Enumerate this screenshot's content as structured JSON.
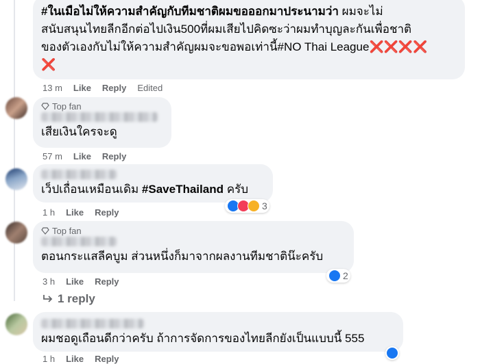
{
  "comments": [
    {
      "text_line1_bold": "#ในเมือไม่ให้ความสำคัญกับทีมชาติผมขอออกมาประนามว่า",
      "text_line1_rest": " ผมจะไม่",
      "text_line2": "สนับสนุนไทยลีกอีกต่อไปเงิน500ที่ผมเสียไปคิดซะว่าผมทำบุญละกันเพื่อชาติ",
      "text_line3": "ของตัวเองกับไม่ให้ความสำคัญผมจะขอพอเท่านี้",
      "hashtag": "#NO Thai League",
      "crosses": "❌❌❌❌",
      "cross_last": "❌",
      "time": "13 m",
      "like": "Like",
      "reply": "Reply",
      "edited": "Edited"
    },
    {
      "badge": "Top fan",
      "text": "เสียเงินใครจะดู",
      "time": "57 m",
      "like": "Like",
      "reply": "Reply"
    },
    {
      "text_plain": "เว็ปเถื่อนเหมือนเดิม ",
      "hashtag": "#SaveThailand",
      "text_end": " ครับ",
      "time": "1 h",
      "like": "Like",
      "reply": "Reply",
      "reaction_count": "3"
    },
    {
      "badge": "Top fan",
      "text": "ตอนกระแสลีคบูม ส่วนหนึ่งก็มาจากผลงานทีมชาติน๊ะครับ",
      "time": "3 h",
      "like": "Like",
      "reply": "Reply",
      "reaction_count": "2",
      "replies_link": "1 reply"
    },
    {
      "text": "ผมชอดูเถือนดีกว่าครับ ถ้าการจัดการของไทยลีกยังเป็นแบบนี้ 555",
      "time": "1 h",
      "like": "Like",
      "reply": "Reply"
    }
  ],
  "colors": {
    "bubble_bg": "#f0f2f5",
    "meta_text": "#65676b",
    "like_blue": "#1877f2",
    "love_red": "#f33e58",
    "haha_yellow": "#f7b125"
  },
  "icons": [
    "diamond-icon",
    "reply-arrow-icon",
    "like-reaction-icon",
    "love-reaction-icon",
    "haha-reaction-icon"
  ]
}
